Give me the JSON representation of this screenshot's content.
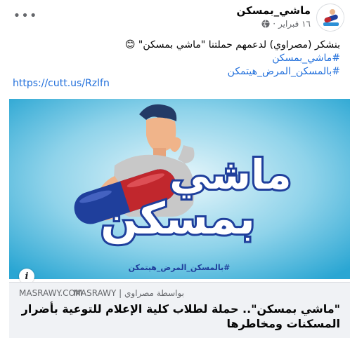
{
  "post": {
    "page_name": "ماشي_بمسكن",
    "date": "١٦ فبراير",
    "privacy_icon": "globe-icon",
    "more_icon": "more-options-icon",
    "text_lines": [
      "بنشكر (مصراوي) لدعمهم حملتنا \"ماشي بمسكن\" 😊"
    ],
    "hashtags": [
      "#ماشي_بمسكن",
      "#بالمسكن_المرض_هيتمكن"
    ],
    "link": "https://cutt.us/Rzlfn"
  },
  "image": {
    "campaign_text": "#بالمسكن_المرض_هيتمكن",
    "logo_text_top": "ماشي",
    "logo_text_bottom": "بمسكن"
  },
  "preview": {
    "domain": "MASRAWY.COM",
    "source": "بواسطة مصراوي | MASRAWY",
    "title": "\"ماشي بمسكن\".. حملة لطلاب كلية الإعلام للتوعية بأضرار المسكنات ومخاطرها",
    "info_icon": "info-icon"
  },
  "colors": {
    "link_blue": "#216fdb",
    "image_bg": "#3fb3d8",
    "pill_red": "#c1272d",
    "logo_blue": "#1f3f9c"
  }
}
